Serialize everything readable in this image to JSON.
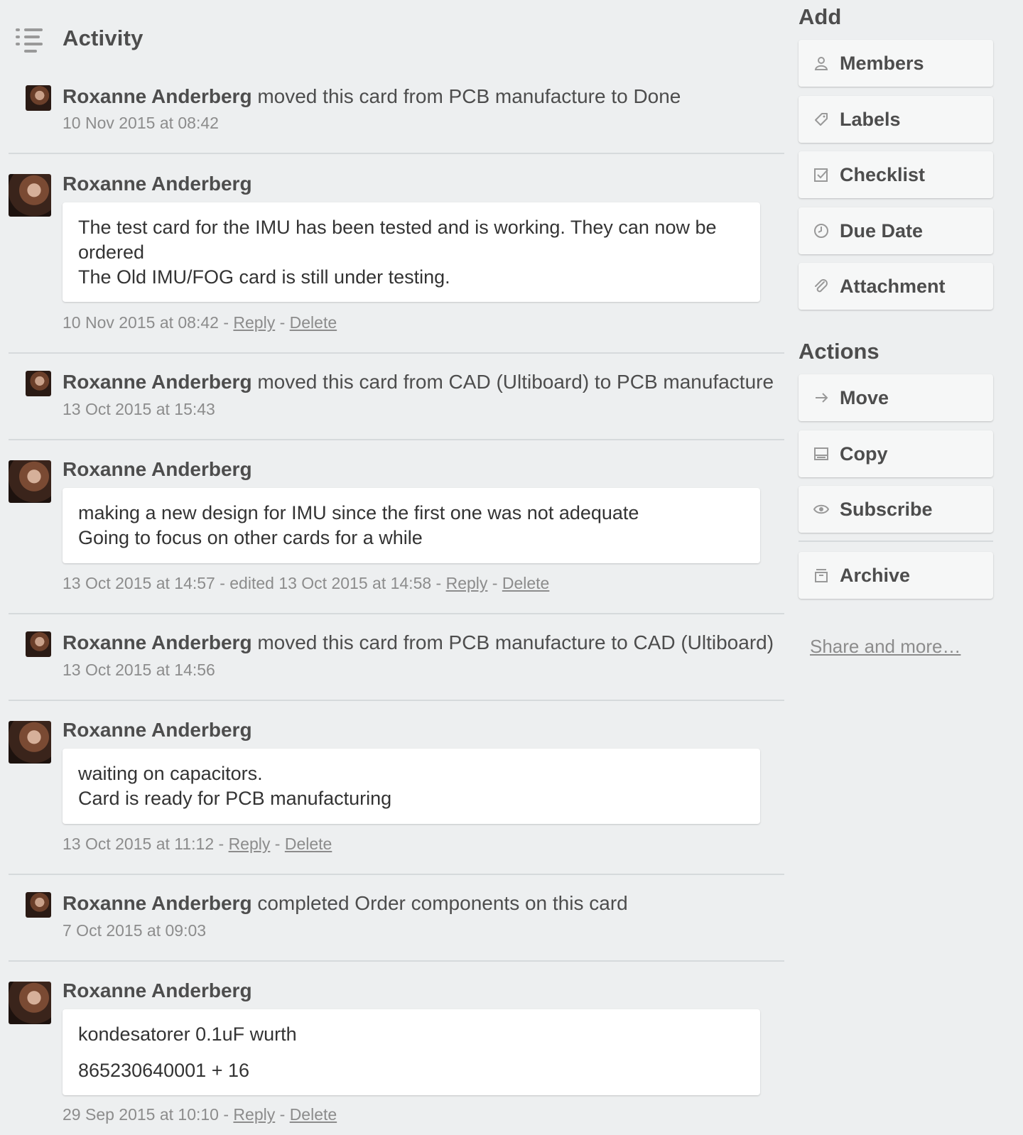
{
  "activity": {
    "title": "Activity",
    "items": [
      {
        "type": "action",
        "author": "Roxanne Anderberg",
        "text": " moved this card from PCB manufacture to Done",
        "time": "10 Nov 2015 at 08:42"
      },
      {
        "type": "comment",
        "author": "Roxanne Anderberg",
        "lines": [
          "The test card for the IMU has been tested and is working. They can now be",
          "ordered",
          "The Old IMU/FOG card is still under testing."
        ],
        "time": "10 Nov 2015 at 08:42 - ",
        "reply": "Reply",
        "sep": " - ",
        "delete": "Delete"
      },
      {
        "type": "action",
        "author": "Roxanne Anderberg",
        "text": " moved this card from CAD (Ultiboard) to PCB manufacture",
        "time": "13 Oct 2015 at 15:43"
      },
      {
        "type": "comment",
        "author": "Roxanne Anderberg",
        "lines": [
          "making a new design for IMU since the first one was not adequate",
          "Going to focus on other cards for a while"
        ],
        "time": "13 Oct 2015 at 14:57 - edited 13 Oct 2015 at 14:58 - ",
        "reply": "Reply",
        "sep": " - ",
        "delete": "Delete"
      },
      {
        "type": "action",
        "author": "Roxanne Anderberg",
        "text": " moved this card from PCB manufacture to CAD (Ultiboard)",
        "time": "13 Oct 2015 at 14:56"
      },
      {
        "type": "comment",
        "author": "Roxanne Anderberg",
        "lines": [
          "waiting on capacitors.",
          "Card is ready for PCB manufacturing"
        ],
        "time": "13 Oct 2015 at 11:12 - ",
        "reply": "Reply",
        "sep": " - ",
        "delete": "Delete"
      },
      {
        "type": "action",
        "author": "Roxanne Anderberg",
        "text": " completed Order components on this card",
        "time": "7 Oct 2015 at 09:03"
      },
      {
        "type": "comment",
        "author": "Roxanne Anderberg",
        "lines": [
          "kondesatorer 0.1uF wurth",
          "865230640001 + 16"
        ],
        "time": "29 Sep 2015 at 10:10 - ",
        "reply": "Reply",
        "sep": " - ",
        "delete": "Delete"
      }
    ]
  },
  "sidebar": {
    "add_title": "Add",
    "add_buttons": [
      {
        "label": "Members",
        "icon": "person-icon"
      },
      {
        "label": "Labels",
        "icon": "tag-icon"
      },
      {
        "label": "Checklist",
        "icon": "checkbox-icon"
      },
      {
        "label": "Due Date",
        "icon": "clock-icon"
      },
      {
        "label": "Attachment",
        "icon": "paperclip-icon"
      }
    ],
    "actions_title": "Actions",
    "action_buttons": [
      {
        "label": "Move",
        "icon": "arrow-right-icon"
      },
      {
        "label": "Copy",
        "icon": "copy-icon"
      },
      {
        "label": "Subscribe",
        "icon": "eye-icon"
      },
      {
        "label": "Archive",
        "icon": "archive-icon"
      }
    ],
    "share": "Share and more…"
  }
}
